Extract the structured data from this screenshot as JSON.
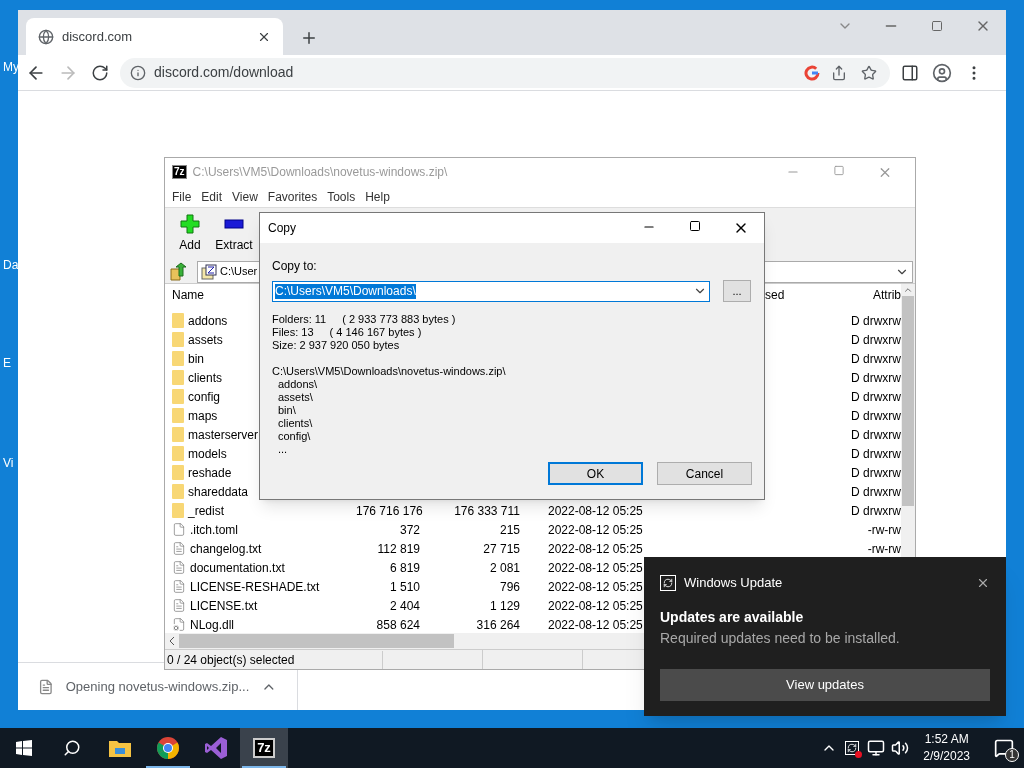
{
  "desktop": {
    "icon_labels": [
      "My",
      "Da",
      "E",
      "Vi"
    ]
  },
  "browser": {
    "tab": {
      "title": "discord.com"
    },
    "url": "discord.com/download",
    "download": {
      "text": "Opening novetus-windows.zip..."
    }
  },
  "archive_window": {
    "logo": "7z",
    "title": "C:\\Users\\VM5\\Downloads\\novetus-windows.zip\\",
    "menu": [
      "File",
      "Edit",
      "View",
      "Favorites",
      "Tools",
      "Help"
    ],
    "toolbar": [
      {
        "label": "Add",
        "kind": "add"
      },
      {
        "label": "Extract",
        "kind": "extract"
      }
    ],
    "path": "C:\\User",
    "columns": {
      "name": "Name",
      "column_2": "sed",
      "attrib": "Attrib"
    },
    "rows": [
      {
        "kind": "folder",
        "name": "addons",
        "attrib": "D drwxrw"
      },
      {
        "kind": "folder",
        "name": "assets",
        "attrib": "D drwxrw"
      },
      {
        "kind": "folder",
        "name": "bin",
        "attrib": "D drwxrw"
      },
      {
        "kind": "folder",
        "name": "clients",
        "attrib": "D drwxrw"
      },
      {
        "kind": "folder",
        "name": "config",
        "attrib": "D drwxrw"
      },
      {
        "kind": "folder",
        "name": "maps",
        "attrib": "D drwxrw"
      },
      {
        "kind": "folder",
        "name": "masterserver",
        "attrib": "D drwxrw"
      },
      {
        "kind": "folder",
        "name": "models",
        "attrib": "D drwxrw"
      },
      {
        "kind": "folder",
        "name": "reshade",
        "attrib": "D drwxrw"
      },
      {
        "kind": "folder",
        "name": "shareddata",
        "attrib": "D drwxrw"
      },
      {
        "kind": "folder",
        "name": "_redist",
        "size": "176 716 176",
        "packed": "176 333 711",
        "modified": "2022-08-12 05:25",
        "attrib": "D drwxrw"
      },
      {
        "kind": "blank",
        "name": ".itch.toml",
        "size": "372",
        "packed": "215",
        "modified": "2022-08-12 05:25",
        "attrib": "-rw-rw"
      },
      {
        "kind": "text",
        "name": "changelog.txt",
        "size": "112 819",
        "packed": "27 715",
        "modified": "2022-08-12 05:25",
        "attrib": "-rw-rw"
      },
      {
        "kind": "text",
        "name": "documentation.txt",
        "size": "6 819",
        "packed": "2 081",
        "modified": "2022-08-12 05:25"
      },
      {
        "kind": "text",
        "name": "LICENSE-RESHADE.txt",
        "size": "1 510",
        "packed": "796",
        "modified": "2022-08-12 05:25"
      },
      {
        "kind": "text",
        "name": "LICENSE.txt",
        "size": "2 404",
        "packed": "1 129",
        "modified": "2022-08-12 05:25"
      },
      {
        "kind": "library",
        "name": "NLog.dll",
        "size": "858 624",
        "packed": "316 264",
        "modified": "2022-08-12 05:25"
      }
    ],
    "status": "0 / 24 object(s) selected"
  },
  "copy_dialog": {
    "title": "Copy",
    "label": "Copy to:",
    "destination": "C:\\Users\\VM5\\Downloads\\",
    "browse": "...",
    "summary": [
      {
        "label": "Folders: 11",
        "detail": "( 2 933 773 883 bytes )"
      },
      {
        "label": "Files: 13",
        "detail": "( 4 146 167 bytes )"
      },
      {
        "label": "Size: 2 937 920 050 bytes"
      }
    ],
    "listing": {
      "root": "C:\\Users\\VM5\\Downloads\\novetus-windows.zip\\",
      "children": [
        "addons\\",
        "assets\\",
        "bin\\",
        "clients\\",
        "config\\",
        "..."
      ]
    },
    "buttons": [
      {
        "label": "OK",
        "default": true
      },
      {
        "label": "Cancel",
        "default": false
      }
    ]
  },
  "notification": {
    "app": "Windows Update",
    "title": "Updates are available",
    "body": "Required updates need to be installed.",
    "action": "View updates"
  },
  "taskbar": {
    "apps": [
      {
        "kind": "explorer",
        "running": false,
        "selected": false
      },
      {
        "kind": "chrome",
        "running": true,
        "selected": false
      },
      {
        "kind": "studio",
        "running": false,
        "selected": false
      },
      {
        "kind": "archiver",
        "label": "7z",
        "running": true,
        "selected": true
      }
    ],
    "clock": {
      "time": "1:52 AM",
      "date": "2/9/2023"
    },
    "notification_count": "1"
  }
}
